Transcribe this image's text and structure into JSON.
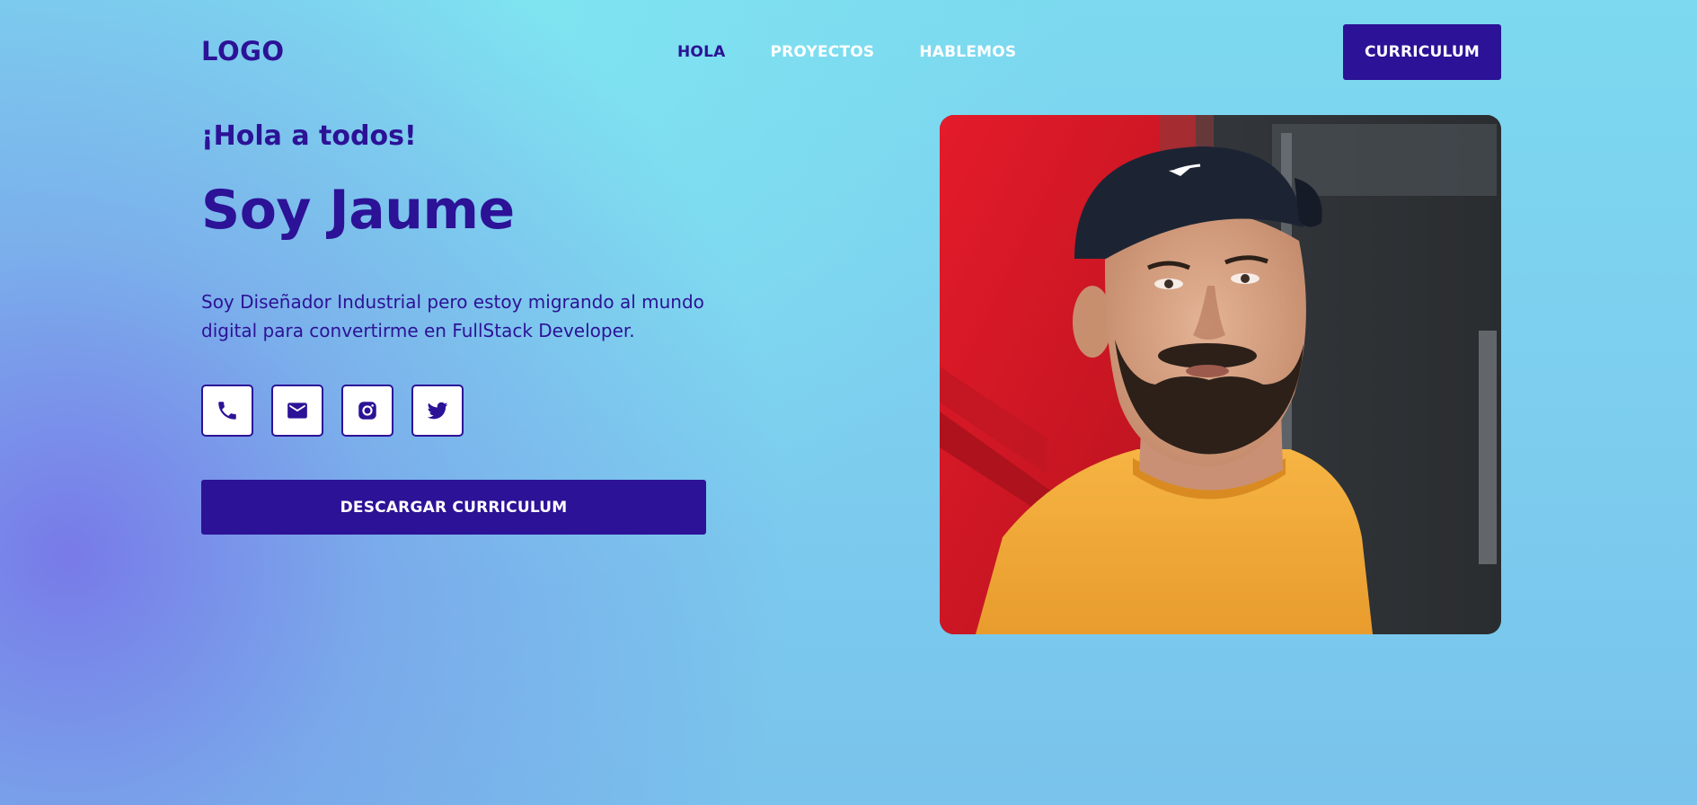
{
  "header": {
    "logo": "LOGO",
    "nav": [
      {
        "label": "HOLA",
        "active": true
      },
      {
        "label": "PROYECTOS",
        "active": false
      },
      {
        "label": "HABLEMOS",
        "active": false
      }
    ],
    "cv_button": "CURRICULUM"
  },
  "hero": {
    "greeting": "¡Hola a todos!",
    "title": "Soy Jaume",
    "bio": "Soy Diseñador Industrial pero estoy migrando al mundo digital para convertirme en FullStack Developer.",
    "socials": [
      {
        "icon": "phone-icon"
      },
      {
        "icon": "mail-icon"
      },
      {
        "icon": "instagram-icon"
      },
      {
        "icon": "twitter-icon"
      }
    ],
    "download_button": "DESCARGAR CURRICULUM"
  },
  "colors": {
    "primary": "#2c1296",
    "white": "#ffffff",
    "background_top": "#7cd9ef",
    "background_accent": "#7876e8"
  }
}
